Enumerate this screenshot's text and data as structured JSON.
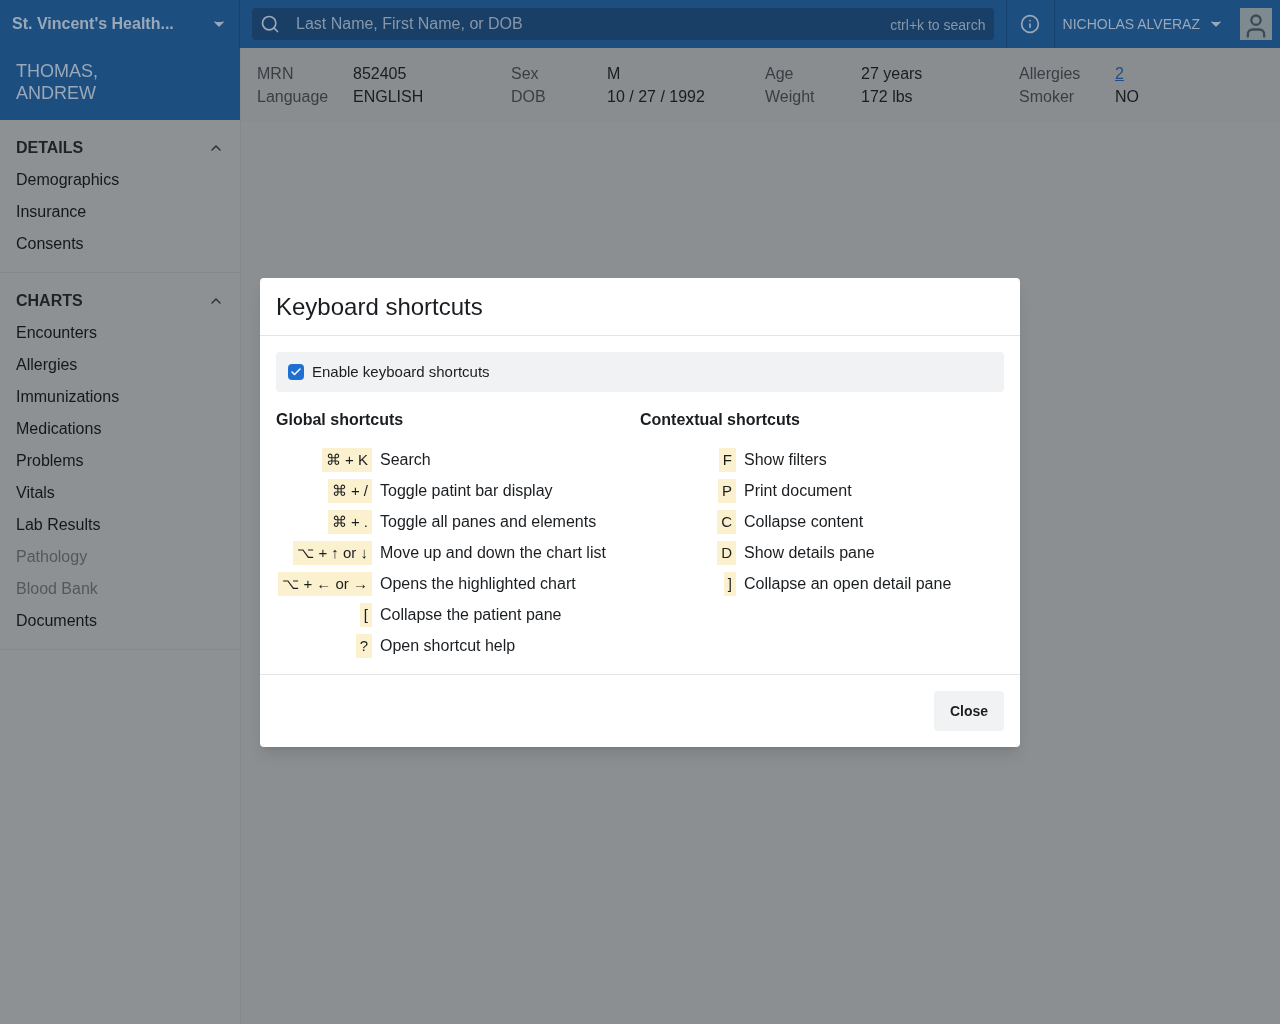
{
  "header": {
    "org": "St. Vincent's Health...",
    "search": {
      "placeholder": "Last Name, First Name, or DOB",
      "hint": "ctrl+k to search"
    },
    "user": "NICHOLAS ALVERAZ"
  },
  "patient": {
    "name": "THOMAS, ANDREW",
    "fields": [
      {
        "label": "MRN",
        "value": "852405",
        "link": false
      },
      {
        "label": "Language",
        "value": "ENGLISH",
        "link": false
      },
      {
        "label": "Sex",
        "value": "M",
        "link": false
      },
      {
        "label": "DOB",
        "value": "10 / 27 / 1992",
        "link": false
      },
      {
        "label": "Age",
        "value": "27 years",
        "link": false
      },
      {
        "label": "Weight",
        "value": "172 lbs",
        "link": false
      },
      {
        "label": "Allergies",
        "value": "2",
        "link": true
      },
      {
        "label": "Smoker",
        "value": "NO",
        "link": false
      }
    ]
  },
  "sidebar": {
    "sections": [
      {
        "title": "DETAILS",
        "expanded": true,
        "items": [
          {
            "label": "Demographics",
            "disabled": false
          },
          {
            "label": "Insurance",
            "disabled": false
          },
          {
            "label": "Consents",
            "disabled": false
          }
        ]
      },
      {
        "title": "CHARTS",
        "expanded": true,
        "items": [
          {
            "label": "Encounters",
            "disabled": false
          },
          {
            "label": "Allergies",
            "disabled": false
          },
          {
            "label": "Immunizations",
            "disabled": false
          },
          {
            "label": "Medications",
            "disabled": false
          },
          {
            "label": "Problems",
            "disabled": false
          },
          {
            "label": "Vitals",
            "disabled": false
          },
          {
            "label": "Lab Results",
            "disabled": false
          },
          {
            "label": "Pathology",
            "disabled": true
          },
          {
            "label": "Blood Bank",
            "disabled": true
          },
          {
            "label": "Documents",
            "disabled": false
          }
        ]
      }
    ]
  },
  "dialog": {
    "title": "Keyboard shortcuts",
    "enable": {
      "label": "Enable keyboard shortcuts",
      "checked": true
    },
    "groups": [
      {
        "title": "Global shortcuts",
        "shortcuts": [
          {
            "key": "⌘ + K",
            "action": "Search"
          },
          {
            "key": "⌘ + /",
            "action": "Toggle patint bar display"
          },
          {
            "key": "⌘ + .",
            "action": "Toggle all panes and elements"
          },
          {
            "key": "⌥ + ↑ or ↓",
            "action": "Move up and down the chart list"
          },
          {
            "key": "⌥ + ← or →",
            "action": "Opens the highlighted chart"
          },
          {
            "key": "[",
            "action": "Collapse the patient pane"
          },
          {
            "key": "?",
            "action": "Open shortcut help"
          }
        ]
      },
      {
        "title": "Contextual shortcuts",
        "shortcuts": [
          {
            "key": "F",
            "action": "Show filters"
          },
          {
            "key": "P",
            "action": "Print document"
          },
          {
            "key": "C",
            "action": "Collapse content"
          },
          {
            "key": "D",
            "action": "Show details pane"
          },
          {
            "key": "]",
            "action": "Collapse an open detail pane"
          }
        ]
      }
    ],
    "close": "Close"
  }
}
